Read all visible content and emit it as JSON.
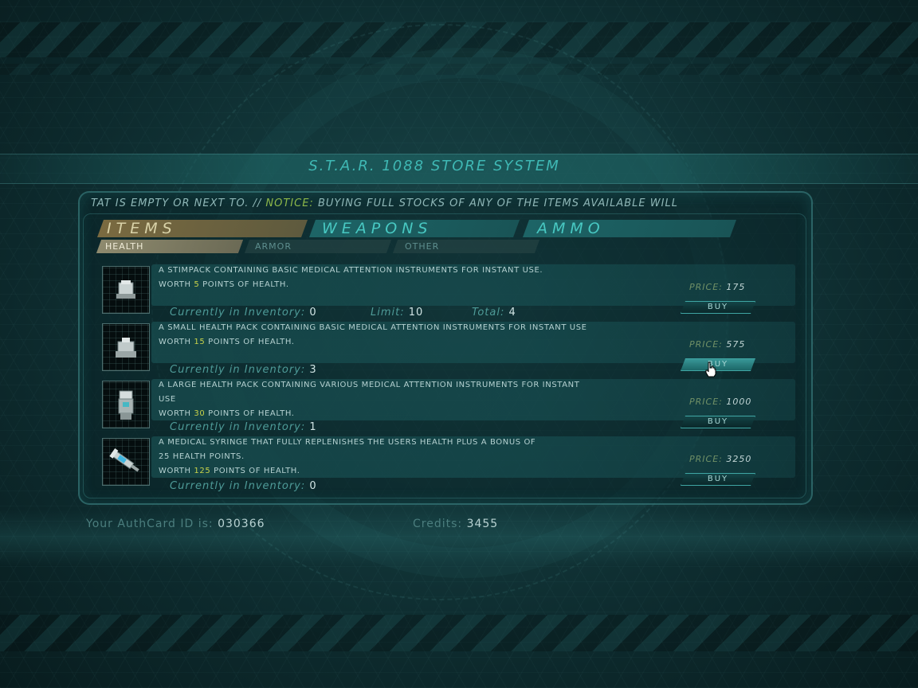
{
  "title": "S.T.A.R. 1088 STORE SYSTEM",
  "ticker": {
    "lead": "TAT IS EMPTY OR NEXT TO. //",
    "notice_label": "NOTICE:",
    "notice_text": "BUYING FULL STOCKS OF ANY OF THE ITEMS AVAILABLE WILL"
  },
  "tabs": [
    {
      "label": "ITEMS",
      "active": true
    },
    {
      "label": "WEAPONS",
      "active": false
    },
    {
      "label": "AMMO",
      "active": false
    }
  ],
  "subtabs": [
    {
      "label": "HEALTH",
      "active": true
    },
    {
      "label": "ARMOR",
      "active": false
    },
    {
      "label": "OTHER",
      "active": false
    }
  ],
  "items": [
    {
      "icon": "stimpack-icon",
      "desc_line1": "A STIMPACK CONTAINING BASIC MEDICAL ATTENTION INSTRUMENTS FOR INSTANT USE.",
      "desc_line2": "",
      "worth_prefix": "WORTH",
      "worth_value": "5",
      "worth_suffix": "POINTS OF HEALTH.",
      "inv_label": "Currently in Inventory:",
      "inv_value": "0",
      "limit_label": "Limit:",
      "limit_value": "10",
      "total_label": "Total:",
      "total_value": "4",
      "price_label": "PRICE:",
      "price_value": "175",
      "buy_label": "BUY"
    },
    {
      "icon": "small-health-pack-icon",
      "desc_line1": "A SMALL HEALTH PACK CONTAINING BASIC MEDICAL ATTENTION INSTRUMENTS FOR INSTANT USE",
      "desc_line2": "",
      "worth_prefix": "WORTH",
      "worth_value": "15",
      "worth_suffix": "POINTS OF HEALTH.",
      "inv_label": "Currently in Inventory:",
      "inv_value": "3",
      "price_label": "PRICE:",
      "price_value": "575",
      "buy_label": "BUY"
    },
    {
      "icon": "large-health-pack-icon",
      "desc_line1": "A LARGE HEALTH PACK CONTAINING VARIOUS MEDICAL ATTENTION INSTRUMENTS FOR INSTANT",
      "desc_line2": "USE",
      "worth_prefix": "WORTH",
      "worth_value": "30",
      "worth_suffix": "POINTS OF HEALTH.",
      "inv_label": "Currently in Inventory:",
      "inv_value": "1",
      "price_label": "PRICE:",
      "price_value": "1000",
      "buy_label": "BUY"
    },
    {
      "icon": "medical-syringe-icon",
      "desc_line1": "A MEDICAL SYRINGE THAT FULLY REPLENISHES THE USERS HEALTH PLUS A BONUS OF",
      "desc_line2": "25 HEALTH POINTS.",
      "worth_prefix": "WORTH",
      "worth_value": "125",
      "worth_suffix": "POINTS OF HEALTH.",
      "inv_label": "Currently in Inventory:",
      "inv_value": "0",
      "price_label": "PRICE:",
      "price_value": "3250",
      "buy_label": "BUY"
    }
  ],
  "footer": {
    "authcard_label": "Your AuthCard ID is:",
    "authcard_value": "030366",
    "credits_label": "Credits:",
    "credits_value": "3455"
  },
  "colors": {
    "accent": "#48c8c2",
    "highlight": "#c8d24a",
    "notice": "#8db84a"
  }
}
